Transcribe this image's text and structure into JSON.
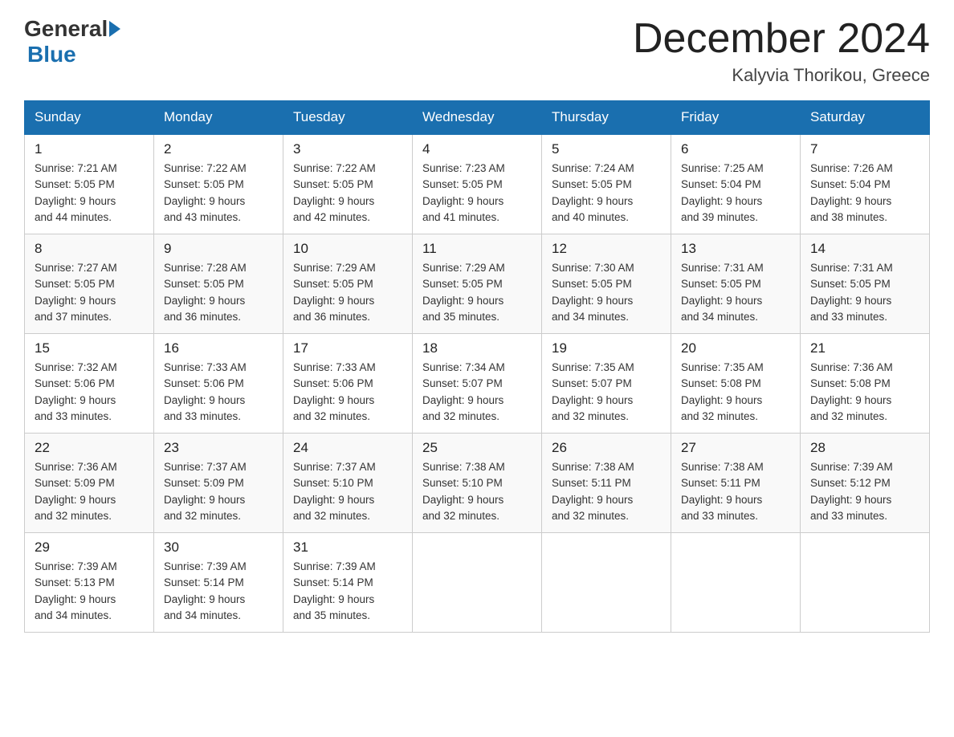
{
  "logo": {
    "general": "General",
    "blue": "Blue"
  },
  "title": "December 2024",
  "location": "Kalyvia Thorikou, Greece",
  "days_of_week": [
    "Sunday",
    "Monday",
    "Tuesday",
    "Wednesday",
    "Thursday",
    "Friday",
    "Saturday"
  ],
  "weeks": [
    [
      {
        "day": "1",
        "sunrise": "7:21 AM",
        "sunset": "5:05 PM",
        "daylight": "9 hours and 44 minutes."
      },
      {
        "day": "2",
        "sunrise": "7:22 AM",
        "sunset": "5:05 PM",
        "daylight": "9 hours and 43 minutes."
      },
      {
        "day": "3",
        "sunrise": "7:22 AM",
        "sunset": "5:05 PM",
        "daylight": "9 hours and 42 minutes."
      },
      {
        "day": "4",
        "sunrise": "7:23 AM",
        "sunset": "5:05 PM",
        "daylight": "9 hours and 41 minutes."
      },
      {
        "day": "5",
        "sunrise": "7:24 AM",
        "sunset": "5:05 PM",
        "daylight": "9 hours and 40 minutes."
      },
      {
        "day": "6",
        "sunrise": "7:25 AM",
        "sunset": "5:04 PM",
        "daylight": "9 hours and 39 minutes."
      },
      {
        "day": "7",
        "sunrise": "7:26 AM",
        "sunset": "5:04 PM",
        "daylight": "9 hours and 38 minutes."
      }
    ],
    [
      {
        "day": "8",
        "sunrise": "7:27 AM",
        "sunset": "5:05 PM",
        "daylight": "9 hours and 37 minutes."
      },
      {
        "day": "9",
        "sunrise": "7:28 AM",
        "sunset": "5:05 PM",
        "daylight": "9 hours and 36 minutes."
      },
      {
        "day": "10",
        "sunrise": "7:29 AM",
        "sunset": "5:05 PM",
        "daylight": "9 hours and 36 minutes."
      },
      {
        "day": "11",
        "sunrise": "7:29 AM",
        "sunset": "5:05 PM",
        "daylight": "9 hours and 35 minutes."
      },
      {
        "day": "12",
        "sunrise": "7:30 AM",
        "sunset": "5:05 PM",
        "daylight": "9 hours and 34 minutes."
      },
      {
        "day": "13",
        "sunrise": "7:31 AM",
        "sunset": "5:05 PM",
        "daylight": "9 hours and 34 minutes."
      },
      {
        "day": "14",
        "sunrise": "7:31 AM",
        "sunset": "5:05 PM",
        "daylight": "9 hours and 33 minutes."
      }
    ],
    [
      {
        "day": "15",
        "sunrise": "7:32 AM",
        "sunset": "5:06 PM",
        "daylight": "9 hours and 33 minutes."
      },
      {
        "day": "16",
        "sunrise": "7:33 AM",
        "sunset": "5:06 PM",
        "daylight": "9 hours and 33 minutes."
      },
      {
        "day": "17",
        "sunrise": "7:33 AM",
        "sunset": "5:06 PM",
        "daylight": "9 hours and 32 minutes."
      },
      {
        "day": "18",
        "sunrise": "7:34 AM",
        "sunset": "5:07 PM",
        "daylight": "9 hours and 32 minutes."
      },
      {
        "day": "19",
        "sunrise": "7:35 AM",
        "sunset": "5:07 PM",
        "daylight": "9 hours and 32 minutes."
      },
      {
        "day": "20",
        "sunrise": "7:35 AM",
        "sunset": "5:08 PM",
        "daylight": "9 hours and 32 minutes."
      },
      {
        "day": "21",
        "sunrise": "7:36 AM",
        "sunset": "5:08 PM",
        "daylight": "9 hours and 32 minutes."
      }
    ],
    [
      {
        "day": "22",
        "sunrise": "7:36 AM",
        "sunset": "5:09 PM",
        "daylight": "9 hours and 32 minutes."
      },
      {
        "day": "23",
        "sunrise": "7:37 AM",
        "sunset": "5:09 PM",
        "daylight": "9 hours and 32 minutes."
      },
      {
        "day": "24",
        "sunrise": "7:37 AM",
        "sunset": "5:10 PM",
        "daylight": "9 hours and 32 minutes."
      },
      {
        "day": "25",
        "sunrise": "7:38 AM",
        "sunset": "5:10 PM",
        "daylight": "9 hours and 32 minutes."
      },
      {
        "day": "26",
        "sunrise": "7:38 AM",
        "sunset": "5:11 PM",
        "daylight": "9 hours and 32 minutes."
      },
      {
        "day": "27",
        "sunrise": "7:38 AM",
        "sunset": "5:11 PM",
        "daylight": "9 hours and 33 minutes."
      },
      {
        "day": "28",
        "sunrise": "7:39 AM",
        "sunset": "5:12 PM",
        "daylight": "9 hours and 33 minutes."
      }
    ],
    [
      {
        "day": "29",
        "sunrise": "7:39 AM",
        "sunset": "5:13 PM",
        "daylight": "9 hours and 34 minutes."
      },
      {
        "day": "30",
        "sunrise": "7:39 AM",
        "sunset": "5:14 PM",
        "daylight": "9 hours and 34 minutes."
      },
      {
        "day": "31",
        "sunrise": "7:39 AM",
        "sunset": "5:14 PM",
        "daylight": "9 hours and 35 minutes."
      },
      null,
      null,
      null,
      null
    ]
  ],
  "labels": {
    "sunrise": "Sunrise:",
    "sunset": "Sunset:",
    "daylight": "Daylight:"
  }
}
